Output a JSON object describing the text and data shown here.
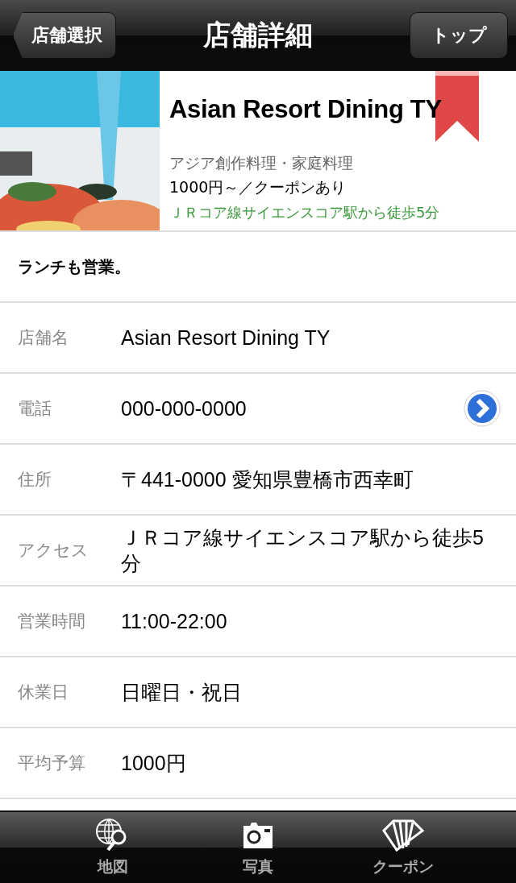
{
  "nav_bar": {
    "back_button": "店舗選択",
    "title": "店舗詳細",
    "right_button": "トップ"
  },
  "shop": {
    "name": "Asian Resort Dining TY",
    "genre": "アジア創作料理・家庭料理",
    "price": "1000円～／クーポンあり",
    "access": "ＪＲコア線サイエンスコア駅から徒歩5分"
  },
  "note": "ランチも営業。",
  "details": [
    {
      "label": "店舗名",
      "value": "Asian Resort Dining TY",
      "kind": "plain"
    },
    {
      "label": "電話",
      "value": "000-000-0000",
      "kind": "link"
    },
    {
      "label": "住所",
      "value": "〒441-0000 愛知県豊橋市西幸町",
      "kind": "plain"
    },
    {
      "label": "アクセス",
      "value": "ＪＲコア線サイエンスコア駅から徒歩5分",
      "kind": "plain"
    },
    {
      "label": "営業時間",
      "value": "11:00-22:00",
      "kind": "plain"
    },
    {
      "label": "休業日",
      "value": "日曜日・祝日",
      "kind": "plain"
    },
    {
      "label": "平均予算",
      "value": "1000円",
      "kind": "plain"
    }
  ],
  "tab_bar": [
    {
      "label": "地図",
      "kind": "map"
    },
    {
      "label": "写真"
    },
    {
      "label": "クーポン",
      "kind": "coupon"
    }
  ]
}
